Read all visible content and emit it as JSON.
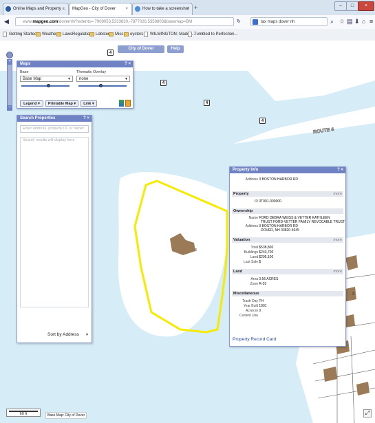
{
  "browser": {
    "tabs": [
      {
        "title": "Online Maps and Property ...",
        "close": "×"
      },
      {
        "title": "MapGeo - City of Dover",
        "close": "×"
      },
      {
        "title": "How to take a screenshot",
        "close": "×"
      }
    ],
    "new_tab": "+",
    "window_controls": [
      "–",
      "□",
      "×"
    ],
    "url_prefix": "www.",
    "url_domain": "mapgeo.com",
    "url_rest": "/dovernh/?extents=-7909053,5333830,-7877026,5358803&basemap=BM",
    "search_query": "tax maps dover nh",
    "bookmarks": [
      "Getting Started",
      "Weather",
      "LawsRegulations",
      "Lobster",
      "Misc",
      "oysters",
      "WILMINGTON: Made i...",
      "Tumbled to Perfection..."
    ]
  },
  "header": {
    "city_button": "City of Dover",
    "help_button": "Help"
  },
  "maps_panel": {
    "title": "Maps",
    "controls": "? ×",
    "base_label": "Base",
    "base_value": "Base Map",
    "base_opacity": 0.55,
    "overlay_label": "Thematic Overlay",
    "overlay_value": "none",
    "overlay_opacity": 0.45,
    "legend_button": "Legend ▾",
    "print_button": "Printable Map ▾",
    "link_button": "Link ▾"
  },
  "search_panel": {
    "title": "Search Properties",
    "controls": "? ×",
    "search_placeholder": "Enter address, property ID, or owner",
    "results_placeholder": "Search results will display here",
    "sort_label": "Sort by",
    "sort_value": "Address"
  },
  "property_panel": {
    "title": "Property Info",
    "controls": "? ×",
    "address_label": "Address",
    "address": "3 BOSTON HARBOR RD",
    "sections": {
      "property": "Property",
      "ownership": "Ownership",
      "valuation": "Valuation",
      "land": "Land",
      "misc": "Miscellaneous",
      "more": "more"
    },
    "id_label": "ID",
    "id": "0T001-000000",
    "owner_name_label": "Name",
    "owner_name_1": "FORD DEBRA WEISS & VETTER KATHLEEN",
    "owner_name_2": "TRUST FORD-VETTER FAMILY REVOCABLE TRUST",
    "owner_address_label": "Address",
    "owner_address_1": "3 BOSTON HARBOR RD",
    "owner_address_2": "DOVER, NH 03820-4645",
    "total_label": "Total",
    "total": "$538,800",
    "buildings_label": "Buildings",
    "buildings": "$243,700",
    "land_value_label": "Land",
    "land_value": "$295,100",
    "last_sale_label": "Last Sale",
    "last_sale": "$",
    "area_label": "Area",
    "area": "0.56 ACRES",
    "zone_label": "Zone",
    "zone": "R-20",
    "trash_label": "Trash Day",
    "trash": "TH",
    "year_built_label": "Year Built",
    "year_built": "1901",
    "acres_label": "Acres in",
    "acres": "0",
    "current_use_label": "Current Use",
    "current_use": "",
    "record_link": "Property Record Card"
  },
  "map": {
    "route_label": "ROUTE 4",
    "route_shields": [
      "4",
      "4",
      "4",
      "4"
    ],
    "parcel_number": "3",
    "parcel_number_2": "3",
    "scale_label": "60 ft",
    "basemap_credit": "Base Map: City of Dover",
    "colors": {
      "water": "#d6ecf7",
      "selection": "#f6ea00",
      "building": "#9a7a57",
      "header": "#6f83c4"
    }
  }
}
